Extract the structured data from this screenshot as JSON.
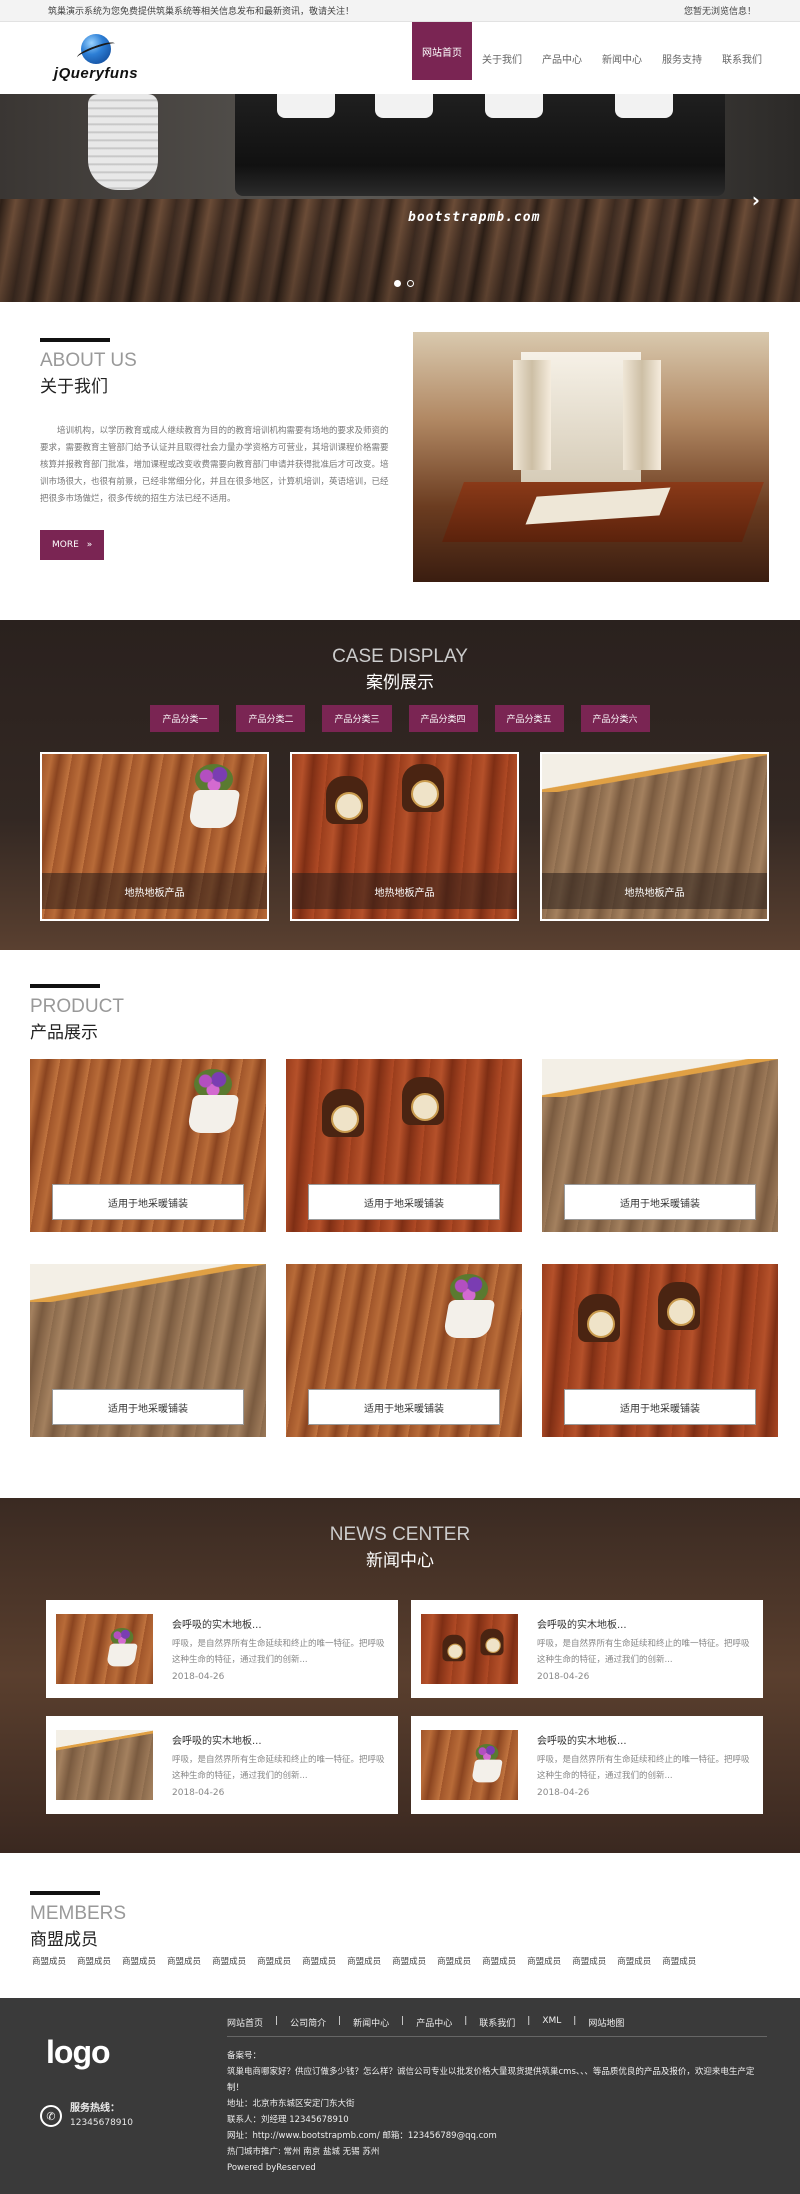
{
  "topbar": {
    "left": "筑巢演示系统为您免费提供筑巢系统等相关信息发布和最新资讯，敬请关注！",
    "right": "您暂无浏览信息！"
  },
  "header": {
    "logo_text": "jQueryfuns",
    "nav": [
      "网站首页",
      "关于我们",
      "产品中心",
      "新闻中心",
      "服务支持",
      "联系我们"
    ],
    "active_index": 0
  },
  "hero": {
    "watermark": "bootstrapmb.com",
    "next_icon": "›",
    "slides": 2,
    "active_slide": 0
  },
  "about": {
    "title_en": "ABOUT US",
    "title_cn": "关于我们",
    "body": "培训机构，以学历教育或成人继续教育为目的的教育培训机构需要有场地的要求及师资的要求，需要教育主管部门给予认证并且取得社会力量办学资格方可营业，其培训课程价格需要核算并报教育部门批准，增加课程或改变收费需要向教育部门申请并获得批准后才可改变。培训市场很大，也很有前景，已经非常细分化，并且在很多地区，计算机培训，英语培训，已经把很多市场做烂，很多传统的招生方法已经不适用。",
    "more_label": "MORE",
    "more_icon": "»"
  },
  "case": {
    "title_en": "CASE DISPLAY",
    "title_cn": "案例展示",
    "categories": [
      "产品分类一",
      "产品分类二",
      "产品分类三",
      "产品分类四",
      "产品分类五",
      "产品分类六"
    ],
    "cards": [
      "地热地板产品",
      "地热地板产品",
      "地热地板产品"
    ]
  },
  "product": {
    "title_en": "PRODUCT",
    "title_cn": "产品展示",
    "items": [
      "适用于地采暖铺装",
      "适用于地采暖铺装",
      "适用于地采暖铺装",
      "适用于地采暖铺装",
      "适用于地采暖铺装",
      "适用于地采暖铺装"
    ]
  },
  "news": {
    "title_en": "NEWS CENTER",
    "title_cn": "新闻中心",
    "items": [
      {
        "title": "会呼吸的实木地板...",
        "desc": "呼吸，是自然界所有生命延续和终止的唯一特征。把呼吸这种生命的特征，通过我们的创新...",
        "date": "2018-04-26"
      },
      {
        "title": "会呼吸的实木地板...",
        "desc": "呼吸，是自然界所有生命延续和终止的唯一特征。把呼吸这种生命的特征，通过我们的创新...",
        "date": "2018-04-26"
      },
      {
        "title": "会呼吸的实木地板...",
        "desc": "呼吸，是自然界所有生命延续和终止的唯一特征。把呼吸这种生命的特征，通过我们的创新...",
        "date": "2018-04-26"
      },
      {
        "title": "会呼吸的实木地板...",
        "desc": "呼吸，是自然界所有生命延续和终止的唯一特征。把呼吸这种生命的特征，通过我们的创新...",
        "date": "2018-04-26"
      }
    ]
  },
  "members": {
    "title_en": "MEMBERS",
    "title_cn": "商盟成员",
    "items": [
      "商盟成员",
      "商盟成员",
      "商盟成员",
      "商盟成员",
      "商盟成员",
      "商盟成员",
      "商盟成员",
      "商盟成员",
      "商盟成员",
      "商盟成员",
      "商盟成员",
      "商盟成员",
      "商盟成员",
      "商盟成员",
      "商盟成员"
    ]
  },
  "footer": {
    "logo": "logo",
    "phone_label": "服务热线：",
    "phone": "12345678910",
    "nav": [
      "网站首页",
      "公司简介",
      "新闻中心",
      "产品中心",
      "联系我们",
      "XML",
      "网站地图"
    ],
    "beian_label": "备案号：",
    "intro": "筑巢电商哪家好？供应订做多少钱？怎么样？诚信公司专业以批发价格大量现货提供筑巢cms、、、等品质优良的产品及报价，欢迎来电生产定制！",
    "address": "地址：北京市东城区安定门东大街",
    "contact": "联系人：刘经理  12345678910",
    "web_mail": "网址：http://www.bootstrapmb.com/   邮箱：123456789@qq.com",
    "cities": "热门城市推广: 常州 南京 盐城 无锡 苏州",
    "powered": "Powered byReserved"
  },
  "colors": {
    "accent": "#7a2553",
    "footer_bg": "#3a3a3a",
    "case_bg": "#2a211e"
  }
}
